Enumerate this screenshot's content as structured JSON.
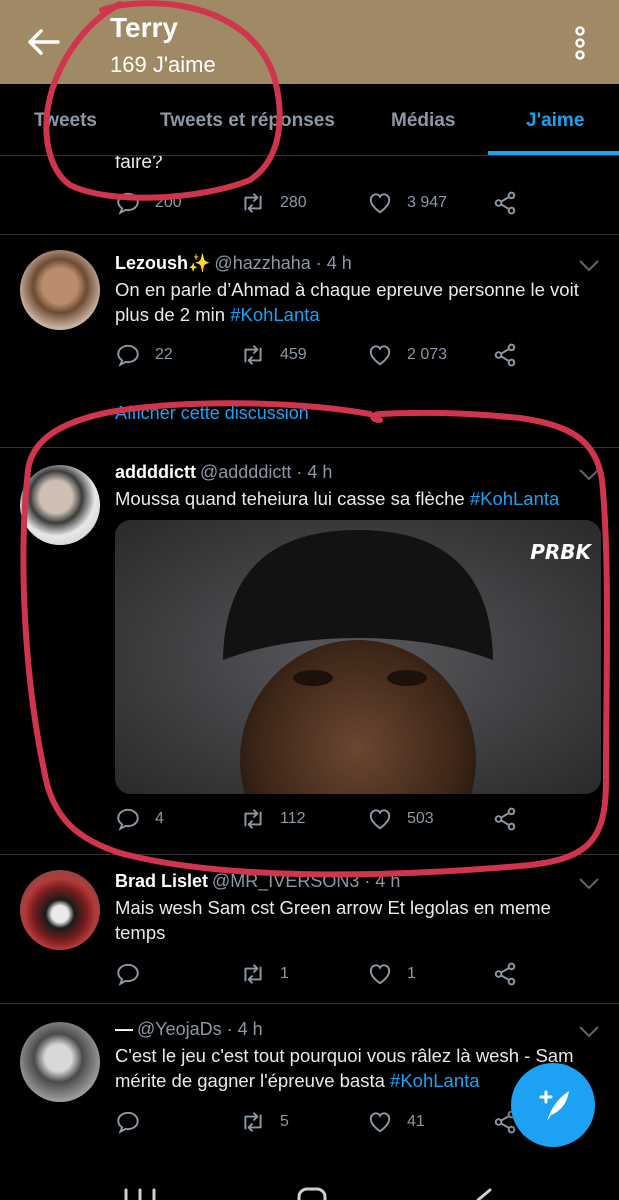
{
  "header": {
    "name": "Terry",
    "likes_count": "169 J'aime"
  },
  "tabs": [
    {
      "label": "Tweets",
      "active": false
    },
    {
      "label": "Tweets et réponses",
      "active": false
    },
    {
      "label": "Médias",
      "active": false
    },
    {
      "label": "J'aime",
      "active": true
    }
  ],
  "colors": {
    "header_bg": "#a08a66",
    "accent": "#1da1f2",
    "muted": "#8b98a5",
    "annotation": "#d1344d"
  },
  "tweets": [
    {
      "text_tail": "faire?",
      "replies": "200",
      "retweets": "280",
      "likes": "3 947"
    },
    {
      "name": "Lezoush✨",
      "handle": "@hazzhaha · 4 h",
      "text": "On en parle d’Ahmad à chaque epreuve personne le voit plus de 2 min",
      "hashtag": "#KohLanta",
      "replies": "22",
      "retweets": "459",
      "likes": "2 073",
      "show_thread": "Afficher cette discussion"
    },
    {
      "name": "addddictt",
      "handle": "@addddictt · 4 h",
      "text": "Moussa quand teheiura lui casse sa flèche",
      "hashtag": "#KohLanta",
      "media_watermark": "PRBK",
      "replies": "4",
      "retweets": "112",
      "likes": "503"
    },
    {
      "name": "Brad Lislet",
      "handle": "@MR_IVERSON3 · 4 h",
      "text": "Mais wesh Sam cst Green arrow Et legolas en meme temps",
      "replies": "",
      "retweets": "1",
      "likes": "1"
    },
    {
      "name": "—",
      "handle": "@YeojaDs · 4 h",
      "text": "C'est le jeu c'est tout pourquoi vous râlez là wesh - Sam mérite de gagner l'épreuve basta",
      "hashtag": "#KohLanta",
      "replies": "",
      "retweets": "5",
      "likes": "41"
    }
  ],
  "icons": [
    "back-arrow-icon",
    "more-vert-icon",
    "reply-icon",
    "retweet-icon",
    "heart-icon",
    "share-icon",
    "chevron-down-icon",
    "compose-tweet-icon"
  ]
}
